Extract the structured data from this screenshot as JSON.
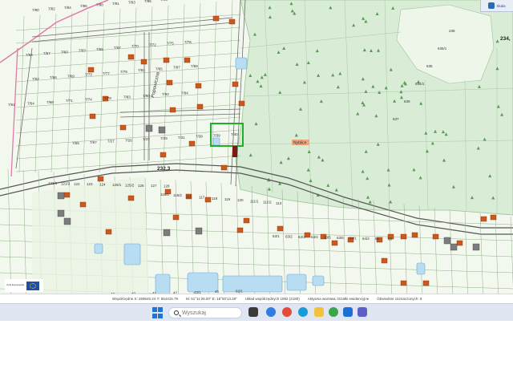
{
  "map": {
    "street_label": "Popowiczna",
    "elevations": [
      "234,",
      "232,3"
    ],
    "badge_label": "Nyblice",
    "plot_labels": {
      "row1": [
        "7/80",
        "7/82",
        "7/84",
        "7/86",
        "7/88",
        "7/91",
        "7/93",
        "7/95",
        "7/96",
        "7/98"
      ],
      "row2": [
        "7/54",
        "7/57",
        "7/60",
        "7/63",
        "7/65",
        "7/67",
        "7/70",
        "7/72",
        "7/75",
        "7/76"
      ],
      "row3": [
        "7/62",
        "7/66",
        "7/69",
        "7/73",
        "7/77",
        "7/79",
        "7/81",
        "7/85",
        "7/87",
        "7/89"
      ],
      "row4": [
        "7/61",
        "7/64",
        "7/68",
        "7/71",
        "7/74",
        "7/78",
        "7/83",
        "7/90",
        "7/92",
        "7/94"
      ],
      "row5": [
        "7/65",
        "7/67",
        "7/27",
        "7/26",
        "7/37",
        "7/29",
        "7/31",
        "7/38",
        "7/39",
        "7/40"
      ],
      "lower_left": [
        "121/1",
        "121/2",
        "122",
        "123",
        "124",
        "125/1",
        "125/2",
        "126",
        "127",
        "128"
      ],
      "lower_mid": [
        "115/1",
        "115/2",
        "116",
        "117",
        "118",
        "119",
        "120",
        "111/1",
        "111/2",
        "113"
      ],
      "lower_right": [
        "63/1",
        "63/2",
        "63/3",
        "63/4",
        "63/5",
        "63/6",
        "64/1",
        "64/2",
        "65",
        "66"
      ],
      "bottom": [
        "44/3",
        "46",
        "47",
        "48",
        "40",
        "41",
        "42",
        "43/1",
        "45",
        "62/1"
      ],
      "forest": [
        "238",
        "636/1",
        "635",
        "634/1",
        "639",
        "637"
      ]
    }
  },
  "top_widget": {
    "label": "Skala"
  },
  "eu_logo": {
    "text": "Unia Europejska"
  },
  "status": {
    "coords": "Współrzędne X: 269645.24 Y: 554415.79",
    "latlon": "M: 51°11'28.00\" E: 18°50'13.28\"",
    "system": "Układ współrzędnych 1992 (2180)",
    "layer": "Aktywna warstwa: Działki ewidencyjne",
    "region": "Obwiednie zaznaczonych: 8"
  },
  "taskbar": {
    "search_placeholder": "Wyszukaj",
    "icons": [
      "task-view",
      "widgets",
      "chrome",
      "edge",
      "file-explorer",
      "chrome-alt",
      "mail",
      "teams",
      "copilot"
    ]
  },
  "colors": {
    "map_bg": "#f3f8ef",
    "forest": "#d8ecd6",
    "parcel_line": "#8fae86",
    "road": "#6b6b6b",
    "building": "#c85a20",
    "water": "#b8dcf2",
    "highlight": "#1fae2c",
    "boundary": "#e07aa8"
  }
}
